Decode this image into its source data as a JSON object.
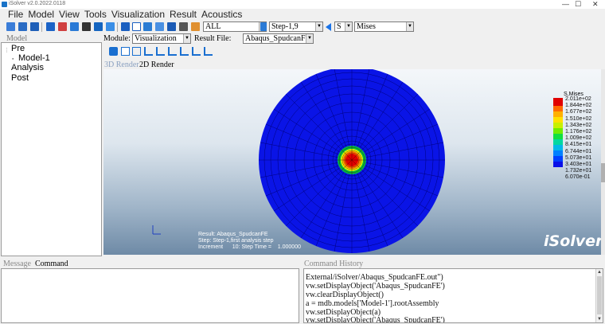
{
  "titlebar": {
    "title": "iSolver v2.0.2022.0118",
    "minimize": "—",
    "maximize": "☐",
    "close": "✕"
  },
  "menu": [
    "File",
    "Model",
    "View",
    "Tools",
    "Visualization",
    "Result",
    "Acoustics"
  ],
  "toolbar": {
    "part_filter": "ALL",
    "step_frame": "Step-1,9",
    "variable": "S",
    "component": "Mises"
  },
  "module_row": {
    "module_label": "Module:",
    "module_value": "Visualization",
    "result_label": "Result File:",
    "result_value": "Abaqus_SpudcanFE"
  },
  "model_panel": {
    "label": "Model",
    "tree": [
      {
        "label": "Pre"
      },
      {
        "label": "Model-1"
      },
      {
        "label": "Analysis"
      },
      {
        "label": "Post"
      }
    ]
  },
  "render_tabs": [
    "3D Render",
    "2D Render"
  ],
  "legend": {
    "title": "S,Mises",
    "values": [
      "2.011e+02",
      "1.844e+02",
      "1.677e+02",
      "1.510e+02",
      "1.343e+02",
      "1.176e+02",
      "1.009e+02",
      "8.415e+01",
      "6.744e+01",
      "5.073e+01",
      "3.403e+01",
      "1.732e+01",
      "6.070e-01"
    ],
    "colors": [
      "#e00000",
      "#ff4a00",
      "#ff9400",
      "#ffd000",
      "#e8f000",
      "#9df000",
      "#3fe600",
      "#00e23a",
      "#00d6a0",
      "#00b2e8",
      "#0076ff",
      "#0040ff",
      "#0a10e8"
    ]
  },
  "viewport_info": {
    "line1": "Result: Abaqus_SpudcanFE",
    "line2": "Step: Step-1,first analysis step",
    "line3": "Increment      10: Step Time =    1.000000",
    "brand": "iSolver"
  },
  "bottom_tabs": {
    "message": "Message",
    "command": "Command",
    "history": "Command History"
  },
  "command_history": [
    "External/iSolver/Abaqus_SpudcanFE.out\")",
    "vw.setDisplayObject('Abaqus_SpudcanFE')",
    "vw.clearDisplayObject()",
    "a = mdb.models['Model-1'].rootAssembly",
    "vw.setDisplayObject(a)",
    "vw.setDisplayObject('Abaqus_SpudcanFE')"
  ]
}
